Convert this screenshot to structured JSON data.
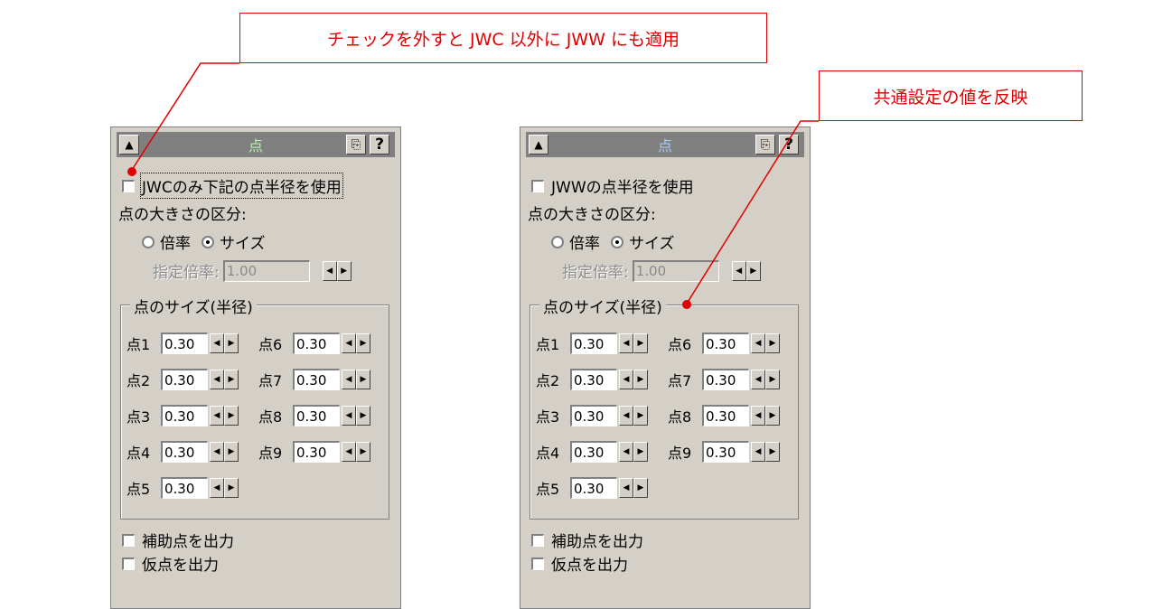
{
  "callouts": {
    "left": "チェックを外すと JWC 以外に JWW にも適用",
    "right": "共通設定の値を反映"
  },
  "colors": {
    "accent": "#e00000",
    "panel_bg": "#d4d0c8",
    "titlebar": "#808080"
  },
  "panels": [
    {
      "title": "点",
      "checkbox_label": "JWCのみ下記の点半径を使用",
      "size_class_label": "点の大きさの区分:",
      "radio_ratio": "倍率",
      "radio_size": "サイズ",
      "selected_radio": "サイズ",
      "ratio_label": "指定倍率:",
      "ratio_value": "1.00",
      "group_label": "点のサイズ(半径)",
      "points": [
        {
          "label": "点1",
          "value": "0.30"
        },
        {
          "label": "点2",
          "value": "0.30"
        },
        {
          "label": "点3",
          "value": "0.30"
        },
        {
          "label": "点4",
          "value": "0.30"
        },
        {
          "label": "点5",
          "value": "0.30"
        },
        {
          "label": "点6",
          "value": "0.30"
        },
        {
          "label": "点7",
          "value": "0.30"
        },
        {
          "label": "点8",
          "value": "0.30"
        },
        {
          "label": "点9",
          "value": "0.30"
        }
      ],
      "aux_label": "補助点を出力",
      "temp_label": "仮点を出力"
    },
    {
      "title": "点",
      "checkbox_label": "JWWの点半径を使用",
      "size_class_label": "点の大きさの区分:",
      "radio_ratio": "倍率",
      "radio_size": "サイズ",
      "selected_radio": "サイズ",
      "ratio_label": "指定倍率:",
      "ratio_value": "1.00",
      "group_label": "点のサイズ(半径)",
      "points": [
        {
          "label": "点1",
          "value": "0.30"
        },
        {
          "label": "点2",
          "value": "0.30"
        },
        {
          "label": "点3",
          "value": "0.30"
        },
        {
          "label": "点4",
          "value": "0.30"
        },
        {
          "label": "点5",
          "value": "0.30"
        },
        {
          "label": "点6",
          "value": "0.30"
        },
        {
          "label": "点7",
          "value": "0.30"
        },
        {
          "label": "点8",
          "value": "0.30"
        },
        {
          "label": "点9",
          "value": "0.30"
        }
      ],
      "aux_label": "補助点を出力",
      "temp_label": "仮点を出力"
    }
  ]
}
